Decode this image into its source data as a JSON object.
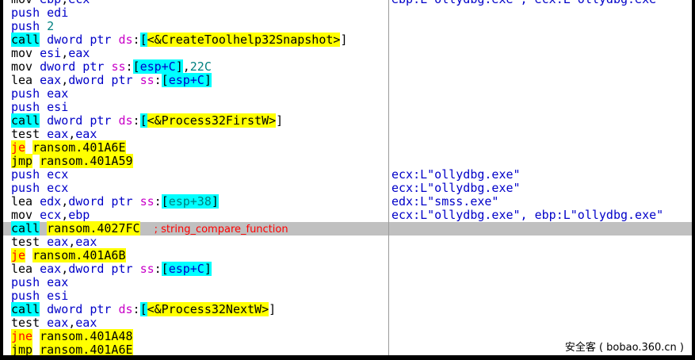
{
  "rows": [
    {
      "tokens": [
        {
          "t": "mov",
          "c": "m-norm"
        },
        {
          "t": " "
        },
        {
          "t": "ebp",
          "c": "reg"
        },
        {
          "t": ",",
          "c": "pl"
        },
        {
          "t": "ecx",
          "c": "reg"
        }
      ],
      "comment": "ebp:L\"ollydbg.exe\", ecx:L\"ollydbg.exe\""
    },
    {
      "tokens": [
        {
          "t": "push",
          "c": "reg"
        },
        {
          "t": " "
        },
        {
          "t": "edi",
          "c": "reg"
        }
      ],
      "comment": ""
    },
    {
      "tokens": [
        {
          "t": "push",
          "c": "reg"
        },
        {
          "t": " "
        },
        {
          "t": "2",
          "c": "num"
        }
      ],
      "comment": ""
    },
    {
      "tokens": [
        {
          "t": "call",
          "c": "m-call"
        },
        {
          "t": " "
        },
        {
          "t": "dword ptr ",
          "c": "reg"
        },
        {
          "t": "ds",
          "c": "seg"
        },
        {
          "t": ":",
          "c": "pl"
        },
        {
          "t": "[",
          "c": "br"
        },
        {
          "t": "<&CreateToolhelp32Snapshot>",
          "c": "sym"
        },
        {
          "t": "]",
          "c": "pl"
        }
      ],
      "comment": ""
    },
    {
      "tokens": [
        {
          "t": "mov",
          "c": "m-norm"
        },
        {
          "t": " "
        },
        {
          "t": "esi",
          "c": "reg"
        },
        {
          "t": ",",
          "c": "pl"
        },
        {
          "t": "eax",
          "c": "reg"
        }
      ],
      "comment": ""
    },
    {
      "tokens": [
        {
          "t": "mov",
          "c": "m-norm"
        },
        {
          "t": " "
        },
        {
          "t": "dword ptr ",
          "c": "reg"
        },
        {
          "t": "ss",
          "c": "seg"
        },
        {
          "t": ":",
          "c": "pl"
        },
        {
          "t": "[",
          "c": "br"
        },
        {
          "t": "esp+C",
          "c": "idx"
        },
        {
          "t": "]",
          "c": "br"
        },
        {
          "t": ",",
          "c": "pl"
        },
        {
          "t": "22C",
          "c": "num"
        }
      ],
      "comment": ""
    },
    {
      "tokens": [
        {
          "t": "lea",
          "c": "m-norm"
        },
        {
          "t": " "
        },
        {
          "t": "eax",
          "c": "reg"
        },
        {
          "t": ",",
          "c": "pl"
        },
        {
          "t": "dword ptr ",
          "c": "reg"
        },
        {
          "t": "ss",
          "c": "seg"
        },
        {
          "t": ":",
          "c": "pl"
        },
        {
          "t": "[",
          "c": "br"
        },
        {
          "t": "esp+C",
          "c": "idx"
        },
        {
          "t": "]",
          "c": "br"
        }
      ],
      "comment": ""
    },
    {
      "tokens": [
        {
          "t": "push",
          "c": "reg"
        },
        {
          "t": " "
        },
        {
          "t": "eax",
          "c": "reg"
        }
      ],
      "comment": ""
    },
    {
      "tokens": [
        {
          "t": "push",
          "c": "reg"
        },
        {
          "t": " "
        },
        {
          "t": "esi",
          "c": "reg"
        }
      ],
      "comment": ""
    },
    {
      "tokens": [
        {
          "t": "call",
          "c": "m-call"
        },
        {
          "t": " "
        },
        {
          "t": "dword ptr ",
          "c": "reg"
        },
        {
          "t": "ds",
          "c": "seg"
        },
        {
          "t": ":",
          "c": "pl"
        },
        {
          "t": "[",
          "c": "br"
        },
        {
          "t": "<&Process32FirstW>",
          "c": "sym"
        },
        {
          "t": "]",
          "c": "pl"
        }
      ],
      "comment": ""
    },
    {
      "tokens": [
        {
          "t": "test",
          "c": "m-norm"
        },
        {
          "t": " "
        },
        {
          "t": "eax",
          "c": "reg"
        },
        {
          "t": ",",
          "c": "pl"
        },
        {
          "t": "eax",
          "c": "reg"
        }
      ],
      "comment": ""
    },
    {
      "tokens": [
        {
          "t": "je",
          "c": "m-jcc"
        },
        {
          "t": " "
        },
        {
          "t": "ransom.401A6E",
          "c": "tgt"
        }
      ],
      "comment": ""
    },
    {
      "tokens": [
        {
          "t": "jmp",
          "c": "m-jmp"
        },
        {
          "t": " "
        },
        {
          "t": "ransom.401A59",
          "c": "tgt"
        }
      ],
      "comment": ""
    },
    {
      "tokens": [
        {
          "t": "push",
          "c": "reg"
        },
        {
          "t": " "
        },
        {
          "t": "ecx",
          "c": "reg"
        }
      ],
      "comment": "ecx:L\"ollydbg.exe\""
    },
    {
      "tokens": [
        {
          "t": "push",
          "c": "reg"
        },
        {
          "t": " "
        },
        {
          "t": "ecx",
          "c": "reg"
        }
      ],
      "comment": "ecx:L\"ollydbg.exe\""
    },
    {
      "tokens": [
        {
          "t": "lea",
          "c": "m-norm"
        },
        {
          "t": " "
        },
        {
          "t": "edx",
          "c": "reg"
        },
        {
          "t": ",",
          "c": "pl"
        },
        {
          "t": "dword ptr ",
          "c": "reg"
        },
        {
          "t": "ss",
          "c": "seg"
        },
        {
          "t": ":",
          "c": "pl"
        },
        {
          "t": "[",
          "c": "br"
        },
        {
          "t": "esp+38",
          "c": "idxn"
        },
        {
          "t": "]",
          "c": "br"
        }
      ],
      "comment": "edx:L\"smss.exe\""
    },
    {
      "tokens": [
        {
          "t": "mov",
          "c": "m-norm"
        },
        {
          "t": " "
        },
        {
          "t": "ecx",
          "c": "reg"
        },
        {
          "t": ",",
          "c": "pl"
        },
        {
          "t": "ebp",
          "c": "reg"
        }
      ],
      "comment": "ecx:L\"ollydbg.exe\", ebp:L\"ollydbg.exe\""
    },
    {
      "tokens": [
        {
          "t": "call",
          "c": "m-call"
        },
        {
          "t": " "
        },
        {
          "t": "ransom.4027FC",
          "c": "tgt"
        },
        {
          "t": "  "
        },
        {
          "t": "; string_compare_function",
          "c": "ann"
        }
      ],
      "comment": "",
      "highlight": true
    },
    {
      "tokens": [
        {
          "t": "test",
          "c": "m-norm"
        },
        {
          "t": " "
        },
        {
          "t": "eax",
          "c": "reg"
        },
        {
          "t": ",",
          "c": "pl"
        },
        {
          "t": "eax",
          "c": "reg"
        }
      ],
      "comment": ""
    },
    {
      "tokens": [
        {
          "t": "je",
          "c": "m-jcc"
        },
        {
          "t": " "
        },
        {
          "t": "ransom.401A6B",
          "c": "tgt"
        }
      ],
      "comment": ""
    },
    {
      "tokens": [
        {
          "t": "lea",
          "c": "m-norm"
        },
        {
          "t": " "
        },
        {
          "t": "eax",
          "c": "reg"
        },
        {
          "t": ",",
          "c": "pl"
        },
        {
          "t": "dword ptr ",
          "c": "reg"
        },
        {
          "t": "ss",
          "c": "seg"
        },
        {
          "t": ":",
          "c": "pl"
        },
        {
          "t": "[",
          "c": "br"
        },
        {
          "t": "esp+C",
          "c": "idx"
        },
        {
          "t": "]",
          "c": "br"
        }
      ],
      "comment": ""
    },
    {
      "tokens": [
        {
          "t": "push",
          "c": "reg"
        },
        {
          "t": " "
        },
        {
          "t": "eax",
          "c": "reg"
        }
      ],
      "comment": ""
    },
    {
      "tokens": [
        {
          "t": "push",
          "c": "reg"
        },
        {
          "t": " "
        },
        {
          "t": "esi",
          "c": "reg"
        }
      ],
      "comment": ""
    },
    {
      "tokens": [
        {
          "t": "call",
          "c": "m-call"
        },
        {
          "t": " "
        },
        {
          "t": "dword ptr ",
          "c": "reg"
        },
        {
          "t": "ds",
          "c": "seg"
        },
        {
          "t": ":",
          "c": "pl"
        },
        {
          "t": "[",
          "c": "br"
        },
        {
          "t": "<&Process32NextW>",
          "c": "sym"
        },
        {
          "t": "]",
          "c": "pl"
        }
      ],
      "comment": ""
    },
    {
      "tokens": [
        {
          "t": "test",
          "c": "m-norm"
        },
        {
          "t": " "
        },
        {
          "t": "eax",
          "c": "reg"
        },
        {
          "t": ",",
          "c": "pl"
        },
        {
          "t": "eax",
          "c": "reg"
        }
      ],
      "comment": ""
    },
    {
      "tokens": [
        {
          "t": "jne",
          "c": "m-jcc"
        },
        {
          "t": " "
        },
        {
          "t": "ransom.401A48",
          "c": "tgt"
        }
      ],
      "comment": ""
    },
    {
      "tokens": [
        {
          "t": "jmp",
          "c": "m-jmp"
        },
        {
          "t": " "
        },
        {
          "t": "ransom.401A6E",
          "c": "tgt"
        }
      ],
      "comment": ""
    }
  ],
  "watermark": "安全客 ( bobao.360.cn )",
  "colors": {
    "register": "#0000c8",
    "segment": "#c800c8",
    "number": "#008080",
    "call_bg": "#00ffff",
    "jump_bg": "#ffff00",
    "jump_cond_fg": "#ff0000",
    "selection": "#c0c0c0",
    "annotation": "#ff0000"
  }
}
